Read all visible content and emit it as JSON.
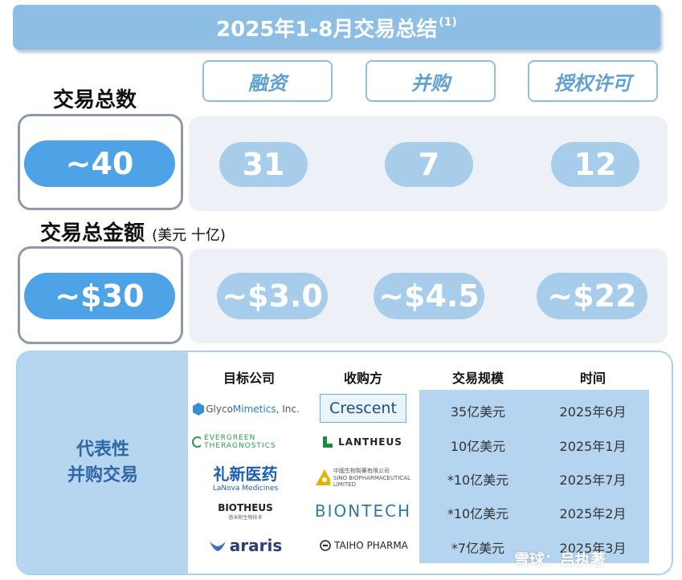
{
  "title": {
    "text": "2025年1-8月交易总结",
    "note": "(1)"
  },
  "categories": [
    "融资",
    "并购",
    "授权许可"
  ],
  "deal_count": {
    "label": "交易总数",
    "total": "~40",
    "values": [
      "31",
      "7",
      "12"
    ]
  },
  "deal_amount": {
    "label": "交易总金额",
    "unit": "(美元 十亿)",
    "total": "~$30",
    "values": [
      "~$3.0",
      "~$4.5",
      "~$22"
    ]
  },
  "ma_table": {
    "side_label_line1": "代表性",
    "side_label_line2": "并购交易",
    "headers": [
      "目标公司",
      "收购方",
      "交易规模",
      "时间"
    ],
    "rows": [
      {
        "target": "GlycoMimetics, Inc.",
        "target_a": "Glyco",
        "target_b": "Mimetics",
        "target_c": ", Inc.",
        "acquirer": "Crescent",
        "size": "35亿美元",
        "date": "2025年6月"
      },
      {
        "target": "EVERGREEN THERAGNOSTICS",
        "acquirer": "LANTHEUS",
        "size": "10亿美元",
        "date": "2025年1月"
      },
      {
        "target_cn": "礼新医药",
        "target_en": "LaNova Medicines",
        "acquirer": "中國生物製藥有限公司",
        "acquirer_en": "SINO BIOPHARMACEUTICAL LIMITED",
        "size": "*10亿美元",
        "date": "2025年7月"
      },
      {
        "target": "BIOTHEUS",
        "target_sub": "普米斯生物技术",
        "acquirer": "BIONTECH",
        "size": "*10亿美元",
        "date": "2025年2月"
      },
      {
        "target": "araris",
        "acquirer": "TAIHO PHARMA",
        "size": "*7亿美元",
        "date": "2025年3月"
      }
    ]
  },
  "watermark": "雪球：吕执著"
}
